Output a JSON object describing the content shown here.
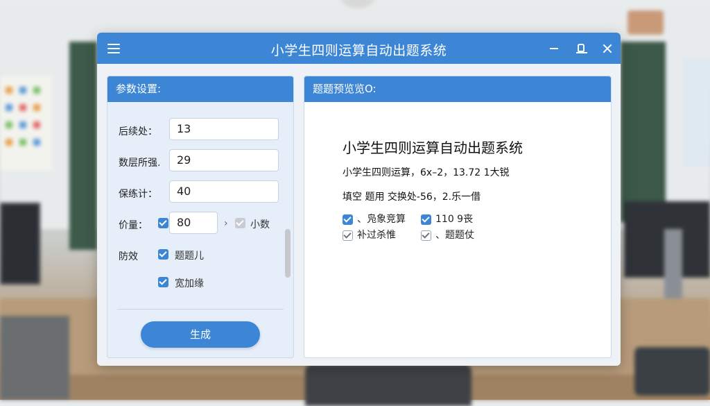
{
  "window": {
    "title": "小学生四则运算自动出题系统"
  },
  "left_panel": {
    "header": "参数设置:",
    "fields": [
      {
        "label": "后续处：",
        "value": "13"
      },
      {
        "label": "数层所强.",
        "value": "29"
      },
      {
        "label": "保练计：",
        "value": "40"
      }
    ],
    "unit_row": {
      "label": "价量：",
      "value": "80",
      "separator": "›",
      "extra_label": "小数"
    },
    "option_row": {
      "label": "防效",
      "opt1": "题题儿",
      "opt2": "宽加缘"
    },
    "generate_label": "生成"
  },
  "right_panel": {
    "header": "题题预览览O:",
    "title": "小学生四则运算自动出题系统",
    "line1": "小学生四则运算，6x–2，13.72 1大锐",
    "line2": "填空 题用 交换处-56，2.乐一借",
    "options": [
      {
        "label": "、凫象竞算",
        "checked": true
      },
      {
        "label": "110 9丧",
        "checked": true
      },
      {
        "label": "补过杀惟",
        "checked": false
      },
      {
        "label": "、题题仗",
        "checked": false
      }
    ]
  },
  "colors": {
    "accent": "#3d86d6",
    "panel_bg": "#e5eef9"
  }
}
